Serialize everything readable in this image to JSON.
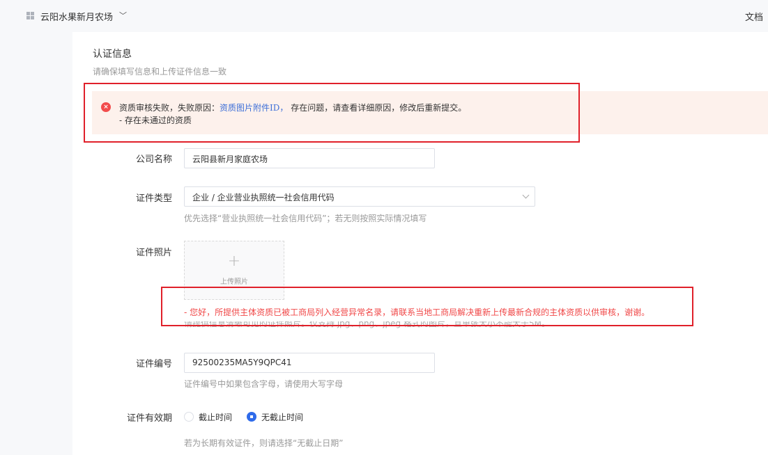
{
  "topbar": {
    "shop_name": "云阳水果新月农场",
    "chevron": "﹀",
    "doc_link": "文档"
  },
  "section": {
    "title": "认证信息",
    "subtitle": "请确保填写信息和上传证件信息一致"
  },
  "alert": {
    "icon": "×",
    "prefix": "资质审核失败，失败原因：",
    "link": "资质图片附件ID，",
    "suffix": "存在问题，请查看详细原因，修改后重新提交。",
    "detail": "- 存在未通过的资质"
  },
  "form": {
    "company_label": "公司名称",
    "company_value": "云阳县新月家庭农场",
    "cert_type_label": "证件类型",
    "cert_type_value": "企业 / 企业营业执照统一社会信用代码",
    "cert_type_hint": "优先选择“营业执照统一社会信用代码”；若无则按照实际情况填写",
    "photo_label": "证件照片",
    "upload_plus": "+",
    "upload_text": "上传照片",
    "photo_error": "- 您好，所提供主体资质已被工商局列入经营异常名录，请联系当地工商局解决重新上传最新合规的主体资质以供审核，谢谢。",
    "photo_hint": "请提供信息清晰可见的证件照片。仅支持 jpg、png、jpeg 格式的图片，且单张大小不能大于5M。",
    "cert_no_label": "证件编号",
    "cert_no_value": "92500235MA5Y9QPC41",
    "cert_no_hint": "证件编号中如果包含字母，请使用大写字母",
    "validity_label": "证件有效期",
    "validity_options": [
      "截止时间",
      "无截止时间"
    ],
    "validity_selected": "无截止时间",
    "validity_hint": "若为长期有效证件，则请选择“无截止日期”"
  },
  "colors": {
    "accent": "#2f6bea",
    "error": "#f04848",
    "alert_bg": "#fdf1ec",
    "annotation": "#e0202a"
  }
}
